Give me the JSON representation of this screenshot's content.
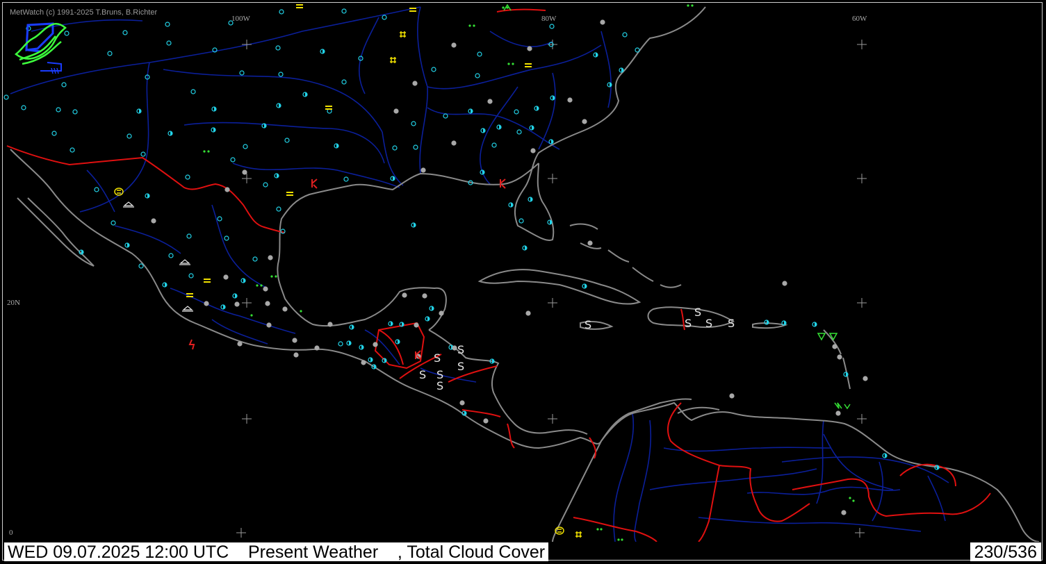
{
  "app": {
    "copyright": "MetWatch  (c) 1991-2025 T.Bruns, B.Richter"
  },
  "map": {
    "longitude_labels": [
      "100W",
      "80W",
      "60W"
    ],
    "latitude_labels": [
      "20N",
      "0"
    ],
    "colors": {
      "background": "#000000",
      "coastline": "#8a8a8a",
      "border": "#e01010",
      "river": "#0b1f9a",
      "station_clear": "#e8e8e8",
      "station_partly": "#22d3e8",
      "station_overcast": "#a8a8a8",
      "fog_symbol": "#f0e000",
      "rain_symbol": "#35e035",
      "thunder_symbol": "#e02020",
      "dust_symbol": "#e0e0e0"
    },
    "legend_icons": [
      "fog-icon",
      "drizzle-icon",
      "rain-shower-icon",
      "thunderstorm-icon",
      "duststorm-icon",
      "haze-icon",
      "lightning-icon"
    ]
  },
  "footer": {
    "left_text": "WED 09.07.2025 12:00 UTC    Present Weather    , Total Cloud Cover",
    "right_text": "230/536"
  }
}
